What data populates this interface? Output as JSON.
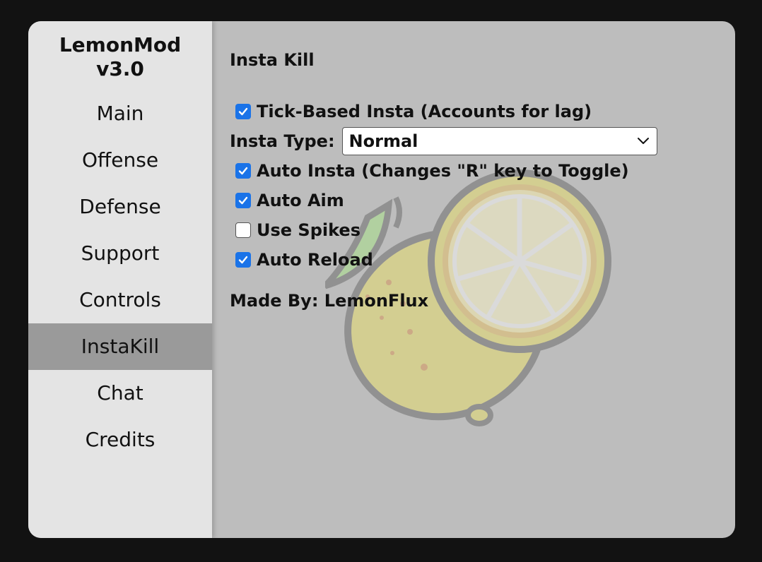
{
  "app": {
    "title_line1": "LemonMod",
    "title_line2": "v3.0"
  },
  "sidebar": {
    "items": [
      {
        "label": "Main"
      },
      {
        "label": "Offense"
      },
      {
        "label": "Defense"
      },
      {
        "label": "Support"
      },
      {
        "label": "Controls"
      },
      {
        "label": "InstaKill",
        "active": true
      },
      {
        "label": "Chat"
      },
      {
        "label": "Credits"
      }
    ]
  },
  "panel": {
    "title": "Insta Kill",
    "options": [
      {
        "label": "Tick-Based Insta (Accounts for lag)",
        "checked": true
      },
      {
        "label": "Auto Insta (Changes \"R\" key to Toggle)",
        "checked": true
      },
      {
        "label": "Auto Aim",
        "checked": true
      },
      {
        "label": "Use Spikes",
        "checked": false
      },
      {
        "label": "Auto Reload",
        "checked": true
      }
    ],
    "insta_type": {
      "label": "Insta Type:",
      "selected": "Normal"
    },
    "credit": "Made By: LemonFlux"
  },
  "colors": {
    "background": "#121212",
    "sidebar_bg": "#e4e4e4",
    "active_nav": "#9a9a9a",
    "content_bg": "#bdbdbd",
    "checkbox_accent": "#1a73e8"
  },
  "icons": {
    "background_art": "lemon-icon",
    "dropdown": "chevron-down-icon",
    "checkmark": "checkmark-icon"
  }
}
